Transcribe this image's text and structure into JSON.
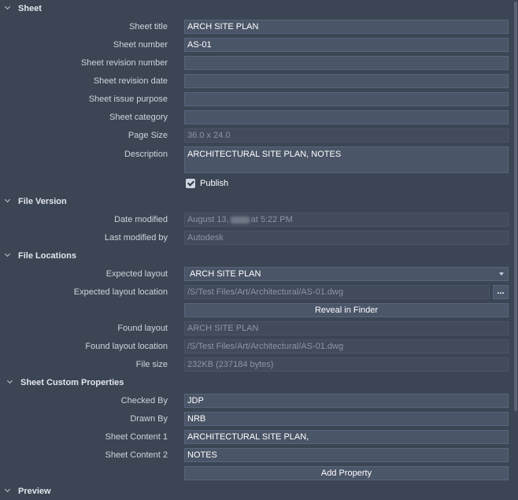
{
  "sections": {
    "sheet": "Sheet",
    "file_version": "File Version",
    "file_locations": "File Locations",
    "custom_props": "Sheet Custom Properties",
    "preview": "Preview"
  },
  "sheet": {
    "title_label": "Sheet title",
    "title_value": "ARCH SITE PLAN",
    "number_label": "Sheet number",
    "number_value": "AS-01",
    "rev_number_label": "Sheet revision number",
    "rev_number_value": "",
    "rev_date_label": "Sheet revision date",
    "rev_date_value": "",
    "issue_purpose_label": "Sheet issue purpose",
    "issue_purpose_value": "",
    "category_label": "Sheet category",
    "category_value": "",
    "page_size_label": "Page Size",
    "page_size_value": "36.0 x 24.0",
    "description_label": "Description",
    "description_value": "ARCHITECTURAL SITE PLAN, NOTES",
    "publish_label": "Publish",
    "publish_checked": true
  },
  "file_version": {
    "date_modified_label": "Date modified",
    "date_modified_prefix": "August 13,",
    "date_modified_suffix": "at 5:22 PM",
    "last_modified_by_label": "Last modified by",
    "last_modified_by_value": "Autodesk"
  },
  "file_locations": {
    "expected_layout_label": "Expected layout",
    "expected_layout_value": "ARCH SITE PLAN",
    "expected_location_label": "Expected layout location",
    "expected_location_value": "/S/Test Files/Art/Architectural/AS-01.dwg",
    "browse_label": "...",
    "reveal_label": "Reveal in Finder",
    "found_layout_label": "Found layout",
    "found_layout_value": "ARCH SITE PLAN",
    "found_location_label": "Found layout location",
    "found_location_value": "/S/Test Files/Art/Architectural/AS-01.dwg",
    "file_size_label": "File size",
    "file_size_value": "232KB (237184 bytes)"
  },
  "custom_props": {
    "checked_by_label": "Checked By",
    "checked_by_value": "JDP",
    "drawn_by_label": "Drawn By",
    "drawn_by_value": "NRB",
    "content1_label": "Sheet Content 1",
    "content1_value": "ARCHITECTURAL SITE PLAN,",
    "content2_label": "Sheet Content 2",
    "content2_value": "NOTES",
    "add_property_label": "Add Property"
  },
  "colors": {
    "background": "#3b4554",
    "field": "#4a5567",
    "field_readonly": "#414b5b"
  }
}
